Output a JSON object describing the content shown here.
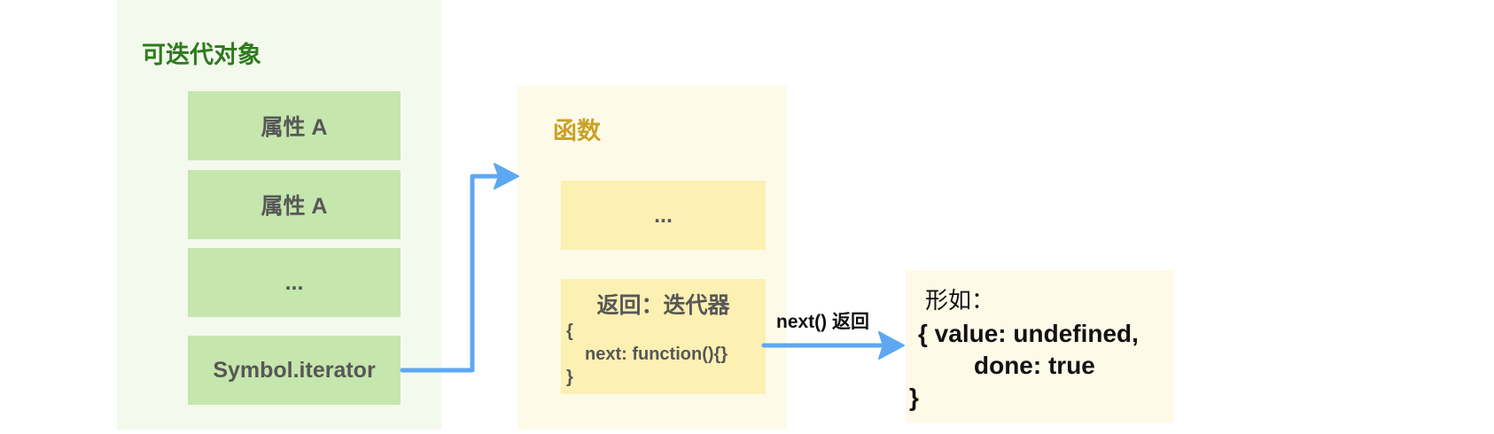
{
  "iterable": {
    "title": "可迭代对象",
    "items": [
      "属性 A",
      "属性 A",
      "...",
      "Symbol.iterator"
    ]
  },
  "function_panel": {
    "title": "函数",
    "dots": "...",
    "return_title": "返回：迭代器",
    "code": [
      "{",
      "next: function(){}",
      "}"
    ]
  },
  "connector": {
    "label": "next() 返回"
  },
  "result": {
    "title": "形如：",
    "lines": [
      "{ value: undefined,",
      "done: true",
      "}"
    ]
  },
  "colors": {
    "iterable_panel": "#f4f9ee",
    "iterable_item": "#c5e6ad",
    "iterable_title": "#2f7a1e",
    "function_panel": "#fefae8",
    "function_item": "#fcf0b3",
    "function_title": "#c9a227",
    "arrow": "#5ea8f2"
  }
}
